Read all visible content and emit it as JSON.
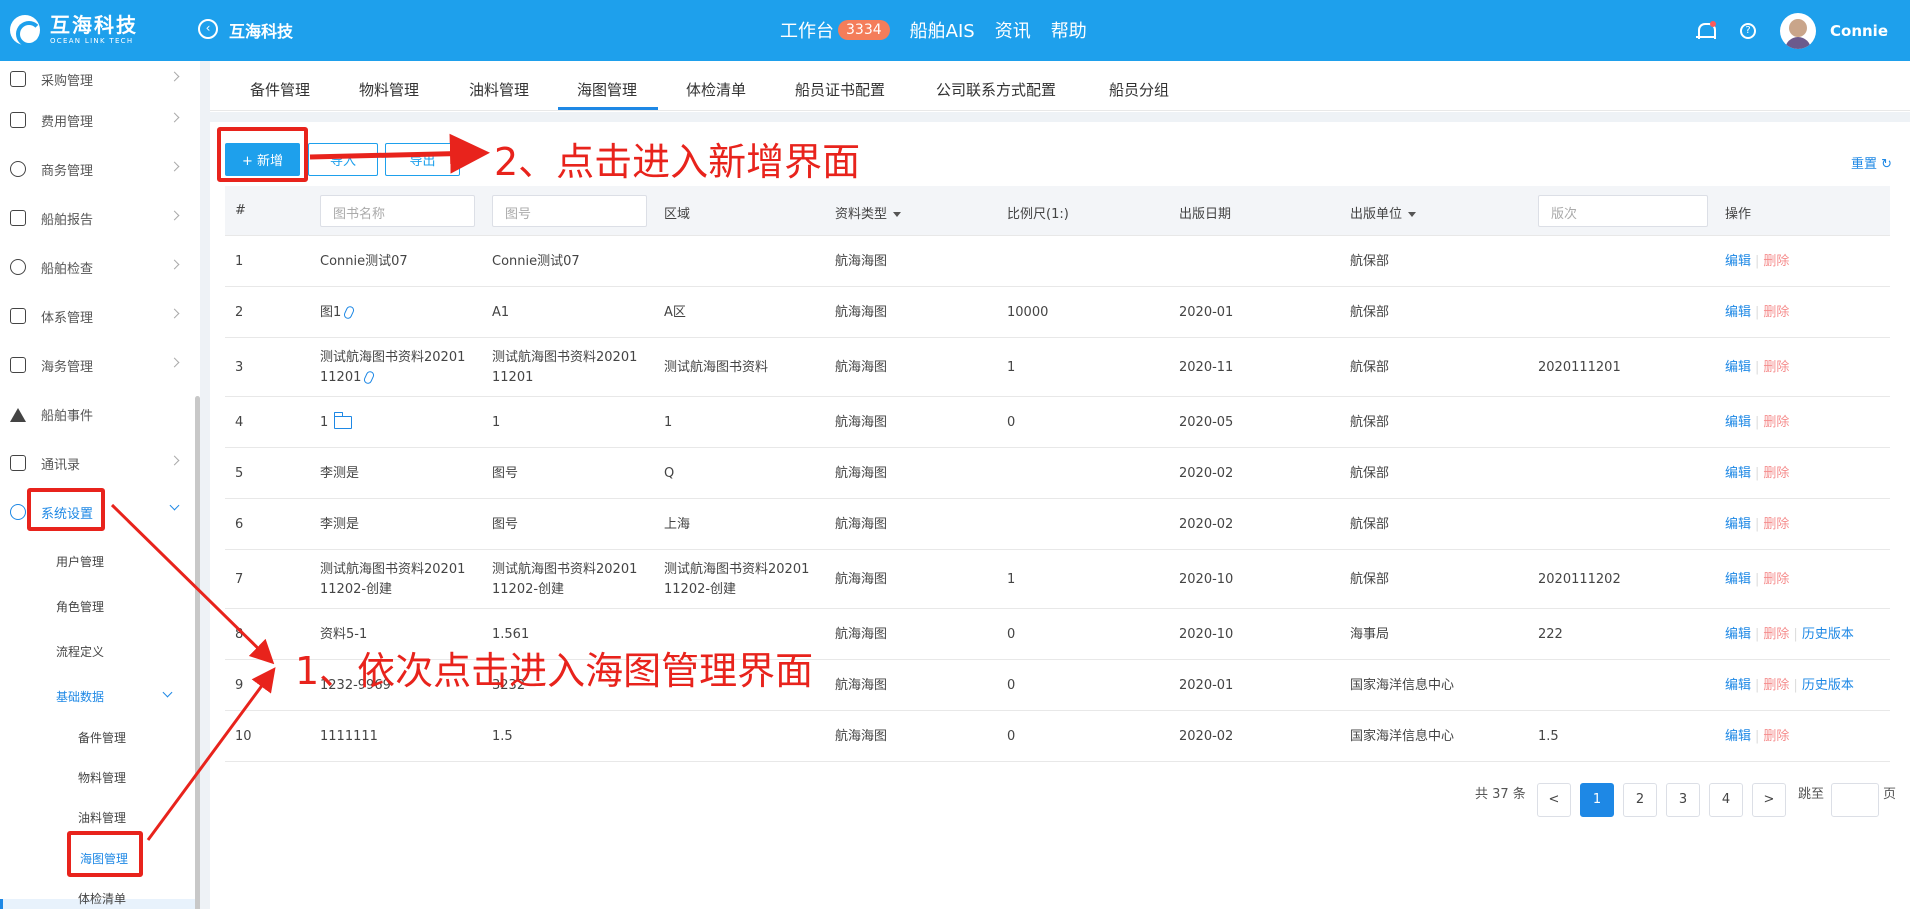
{
  "header": {
    "logo_title": "互海科技",
    "logo_subtitle": "OCEAN LINK TECH",
    "company": "互海科技",
    "nav": [
      {
        "label": "工作台",
        "badge": "3334"
      },
      {
        "label": "船舶AIS"
      },
      {
        "label": "资讯"
      },
      {
        "label": "帮助"
      }
    ],
    "user": "Connie"
  },
  "sidebar": {
    "items": [
      {
        "label": "采购管理"
      },
      {
        "label": "费用管理"
      },
      {
        "label": "商务管理"
      },
      {
        "label": "船舶报告"
      },
      {
        "label": "船舶检查"
      },
      {
        "label": "体系管理"
      },
      {
        "label": "海务管理"
      },
      {
        "label": "船舶事件"
      },
      {
        "label": "通讯录"
      },
      {
        "label": "系统设置"
      }
    ],
    "sub_items": [
      "用户管理",
      "角色管理",
      "流程定义",
      "基础数据"
    ],
    "sub_sub_items": [
      "备件管理",
      "物料管理",
      "油料管理",
      "海图管理",
      "体检清单"
    ]
  },
  "tabs": [
    "备件管理",
    "物料管理",
    "油料管理",
    "海图管理",
    "体检清单",
    "船员证书配置",
    "公司联系方式配置",
    "船员分组"
  ],
  "active_tab": "海图管理",
  "toolbar": {
    "add": "+ 新增",
    "import": "导入",
    "export": "导出",
    "reset": "重置"
  },
  "table": {
    "headers": {
      "index": "#",
      "name_placeholder": "图书名称",
      "code_placeholder": "图号",
      "region": "区域",
      "type": "资料类型",
      "scale": "比例尺(1:)",
      "date": "出版日期",
      "publisher": "出版单位",
      "edition_placeholder": "版次",
      "ops": "操作"
    },
    "rows": [
      {
        "idx": "1",
        "name": "Connie测试07",
        "code": "Connie测试07",
        "region": "",
        "type": "航海海图",
        "scale": "",
        "date": "",
        "publisher": "航保部",
        "edition": ""
      },
      {
        "idx": "2",
        "name": "图1",
        "code": "A1",
        "region": "A区",
        "type": "航海海图",
        "scale": "10000",
        "date": "2020-01",
        "publisher": "航保部",
        "edition": ""
      },
      {
        "idx": "3",
        "name": "测试航海图书资料20201 11201",
        "code": "测试航海图书资料20201 11201",
        "region": "测试航海图书资料",
        "type": "航海海图",
        "scale": "1",
        "date": "2020-11",
        "publisher": "航保部",
        "edition": "2020111201"
      },
      {
        "idx": "4",
        "name": "1",
        "code": "1",
        "region": "1",
        "type": "航海海图",
        "scale": "0",
        "date": "2020-05",
        "publisher": "航保部",
        "edition": ""
      },
      {
        "idx": "5",
        "name": "李测是",
        "code": "图号",
        "region": "Q",
        "type": "航海海图",
        "scale": "",
        "date": "2020-02",
        "publisher": "航保部",
        "edition": ""
      },
      {
        "idx": "6",
        "name": "李测是",
        "code": "图号",
        "region": "上海",
        "type": "航海海图",
        "scale": "",
        "date": "2020-02",
        "publisher": "航保部",
        "edition": ""
      },
      {
        "idx": "7",
        "name": "测试航海图书资料20201 11202-创建",
        "code": "测试航海图书资料20201 11202-创建",
        "region": "测试航海图书资料20201 11202-创建",
        "type": "航海海图",
        "scale": "1",
        "date": "2020-10",
        "publisher": "航保部",
        "edition": "2020111202"
      },
      {
        "idx": "8",
        "name": "资料5-1",
        "code": "1.561",
        "region": "",
        "type": "航海海图",
        "scale": "0",
        "date": "2020-10",
        "publisher": "海事局",
        "edition": "222"
      },
      {
        "idx": "9",
        "name": "1232-9969",
        "code": "3232",
        "region": "",
        "type": "航海海图",
        "scale": "0",
        "date": "2020-01",
        "publisher": "国家海洋信息中心",
        "edition": ""
      },
      {
        "idx": "10",
        "name": "1111111",
        "code": "1.5",
        "region": "",
        "type": "航海海图",
        "scale": "0",
        "date": "2020-02",
        "publisher": "国家海洋信息中心",
        "edition": "1.5"
      }
    ],
    "ops": {
      "edit": "编辑",
      "delete": "删除",
      "history": "历史版本"
    }
  },
  "pagination": {
    "total": "共 37 条",
    "prev": "<",
    "pages": [
      "1",
      "2",
      "3",
      "4"
    ],
    "next": ">",
    "jump_label": "跳至",
    "page_unit": "页"
  },
  "annotations": {
    "step1": "1、依次点击进入海图管理界面",
    "step2": "2、点击进入新增界面"
  },
  "colors": {
    "primary": "#1ea0ec",
    "annotation": "#e8231c",
    "badge": "#f47d5a"
  }
}
